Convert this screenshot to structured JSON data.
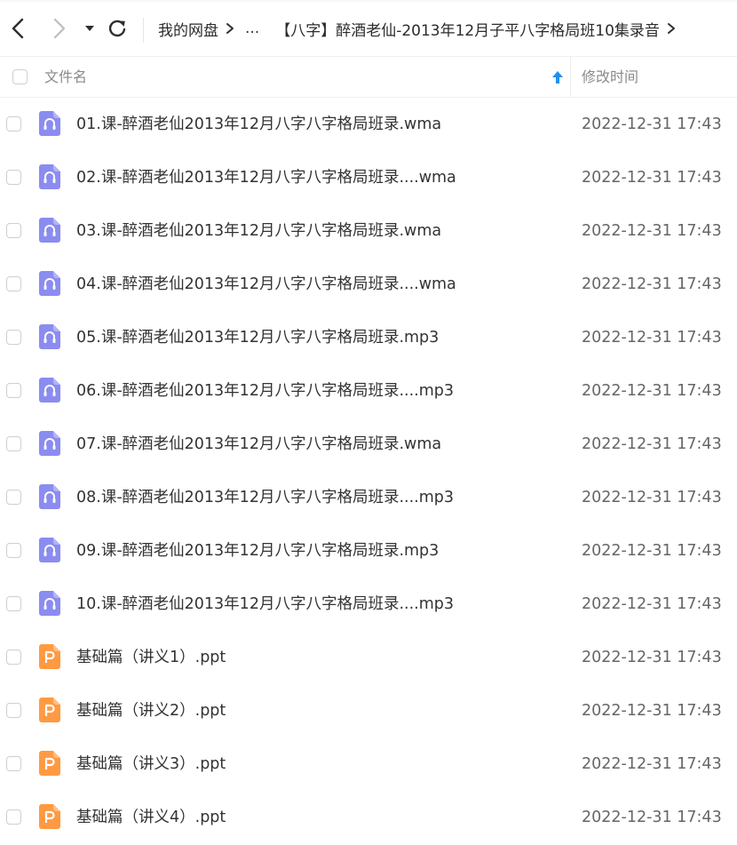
{
  "toolbar": {
    "back_icon": "chevron-left-icon",
    "forward_icon": "chevron-right-icon",
    "history_icon": "caret-down-icon",
    "refresh_icon": "refresh-icon"
  },
  "breadcrumb": {
    "root": "我的网盘",
    "ellipsis": "...",
    "current": "【八字】醉酒老仙-2013年12月子平八字格局班10集录音"
  },
  "list_header": {
    "name_label": "文件名",
    "time_label": "修改时间",
    "sort_icon": "arrow-up-icon"
  },
  "colors": {
    "audio_icon": "#8b8cf0",
    "ppt_icon": "#ff9a42",
    "sort_arrow": "#1e90f0"
  },
  "files": [
    {
      "name": "01.课-醉酒老仙2013年12月八字八字格局班录.wma",
      "time": "2022-12-31 17:43",
      "type": "audio"
    },
    {
      "name": "02.课-醉酒老仙2013年12月八字八字格局班录....wma",
      "time": "2022-12-31 17:43",
      "type": "audio"
    },
    {
      "name": "03.课-醉酒老仙2013年12月八字八字格局班录.wma",
      "time": "2022-12-31 17:43",
      "type": "audio"
    },
    {
      "name": "04.课-醉酒老仙2013年12月八字八字格局班录....wma",
      "time": "2022-12-31 17:43",
      "type": "audio"
    },
    {
      "name": "05.课-醉酒老仙2013年12月八字八字格局班录.mp3",
      "time": "2022-12-31 17:43",
      "type": "audio"
    },
    {
      "name": "06.课-醉酒老仙2013年12月八字八字格局班录....mp3",
      "time": "2022-12-31 17:43",
      "type": "audio"
    },
    {
      "name": "07.课-醉酒老仙2013年12月八字八字格局班录.wma",
      "time": "2022-12-31 17:43",
      "type": "audio"
    },
    {
      "name": "08.课-醉酒老仙2013年12月八字八字格局班录....mp3",
      "time": "2022-12-31 17:43",
      "type": "audio"
    },
    {
      "name": "09.课-醉酒老仙2013年12月八字八字格局班录.mp3",
      "time": "2022-12-31 17:43",
      "type": "audio"
    },
    {
      "name": "10.课-醉酒老仙2013年12月八字八字格局班录....mp3",
      "time": "2022-12-31 17:43",
      "type": "audio"
    },
    {
      "name": "基础篇（讲义1）.ppt",
      "time": "2022-12-31 17:43",
      "type": "ppt"
    },
    {
      "name": "基础篇（讲义2）.ppt",
      "time": "2022-12-31 17:43",
      "type": "ppt"
    },
    {
      "name": "基础篇（讲义3）.ppt",
      "time": "2022-12-31 17:43",
      "type": "ppt"
    },
    {
      "name": "基础篇（讲义4）.ppt",
      "time": "2022-12-31 17:43",
      "type": "ppt"
    }
  ]
}
